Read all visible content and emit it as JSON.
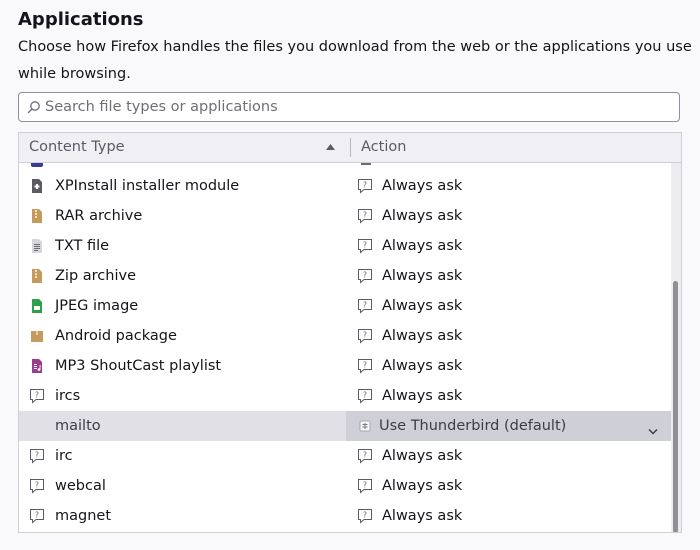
{
  "section": {
    "title": "Applications",
    "description": "Choose how Firefox handles the files you download from the web or the applications you use while browsing."
  },
  "search": {
    "placeholder": "Search file types or applications",
    "value": ""
  },
  "table": {
    "columns": {
      "content_type": "Content Type",
      "action": "Action"
    },
    "sort_direction": "ascending",
    "rows": [
      {
        "type": "XPInstall installer module",
        "icon": "puzzle-file-icon",
        "action": "Always ask",
        "action_icon": "always-ask-icon"
      },
      {
        "type": "RAR archive",
        "icon": "archive-file-icon",
        "action": "Always ask",
        "action_icon": "always-ask-icon"
      },
      {
        "type": "TXT file",
        "icon": "text-file-icon",
        "action": "Always ask",
        "action_icon": "always-ask-icon"
      },
      {
        "type": "Zip archive",
        "icon": "archive-file-icon",
        "action": "Always ask",
        "action_icon": "always-ask-icon"
      },
      {
        "type": "JPEG image",
        "icon": "image-file-icon",
        "action": "Always ask",
        "action_icon": "always-ask-icon"
      },
      {
        "type": "Android package",
        "icon": "package-file-icon",
        "action": "Always ask",
        "action_icon": "always-ask-icon"
      },
      {
        "type": "MP3 ShoutCast playlist",
        "icon": "audio-file-icon",
        "action": "Always ask",
        "action_icon": "always-ask-icon"
      },
      {
        "type": "ircs",
        "icon": "chat-bubble-icon",
        "action": "Always ask",
        "action_icon": "always-ask-icon"
      },
      {
        "type": "mailto",
        "icon": "",
        "action": "Use Thunderbird (default)",
        "action_icon": "thunderbird-icon",
        "selected": true
      },
      {
        "type": "irc",
        "icon": "chat-bubble-icon",
        "action": "Always ask",
        "action_icon": "always-ask-icon"
      },
      {
        "type": "webcal",
        "icon": "chat-bubble-icon",
        "action": "Always ask",
        "action_icon": "always-ask-icon"
      },
      {
        "type": "magnet",
        "icon": "chat-bubble-icon",
        "action": "Always ask",
        "action_icon": "always-ask-icon"
      }
    ]
  },
  "colors": {
    "archive": "#c59a5d",
    "image": "#2da14b",
    "audio": "#9b3d8f",
    "icon_gray": "#6b6b76",
    "selected_row": "#e0e0e6",
    "select_bg": "#cfcfd8"
  }
}
